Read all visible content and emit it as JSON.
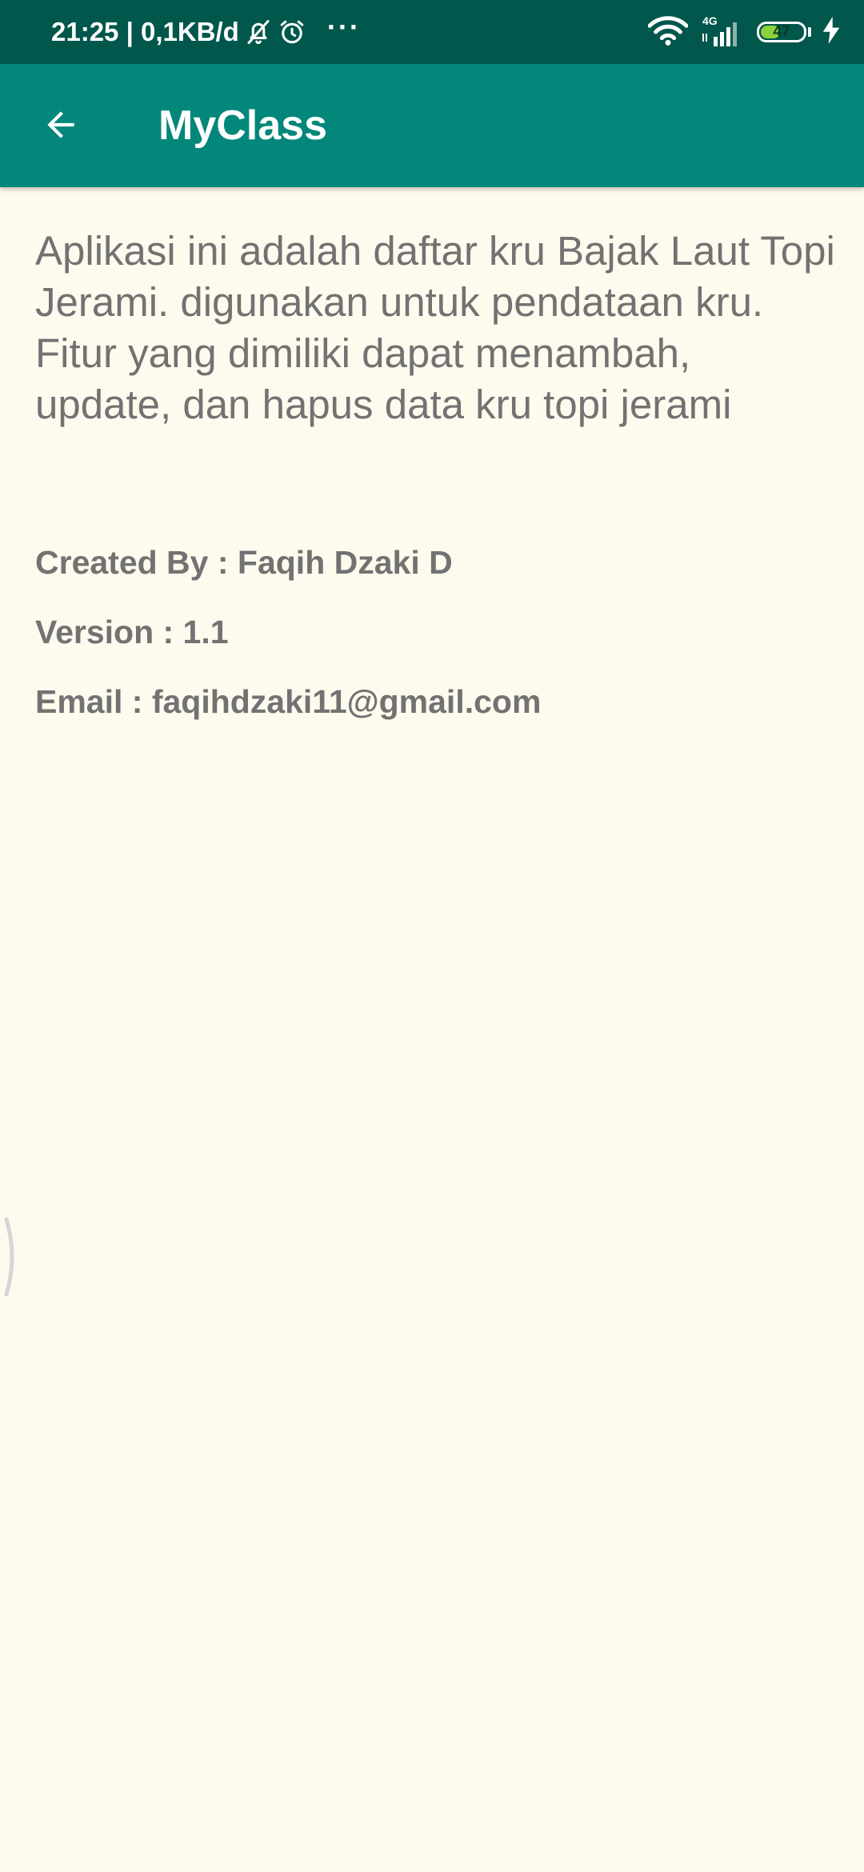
{
  "status_bar": {
    "time_and_speed": "21:25 | 0,1KB/d",
    "network_type": "4G",
    "battery_level": "47",
    "battery_fraction": 0.47,
    "icons": [
      "bell-off-icon",
      "alarm-clock-icon",
      "more-dots-icon",
      "wifi-icon",
      "signal-icon",
      "battery-icon",
      "charging-bolt-icon"
    ]
  },
  "app_bar": {
    "title": "MyClass",
    "back_icon": "arrow-left-icon"
  },
  "content": {
    "description": "Aplikasi ini adalah daftar kru Bajak Laut Topi Jerami. digunakan untuk pendataan kru. Fitur yang dimiliki dapat menambah, update, dan hapus data kru topi jerami",
    "created_by": "Created By : Faqih Dzaki D",
    "version": "Version : 1.1",
    "email": "Email : faqihdzaki11@gmail.com"
  },
  "colors": {
    "status_bar": "#01574B",
    "app_bar": "#02877A",
    "background": "#FFFAEE",
    "text": "#727272",
    "battery_fill": "#8BD33C"
  }
}
